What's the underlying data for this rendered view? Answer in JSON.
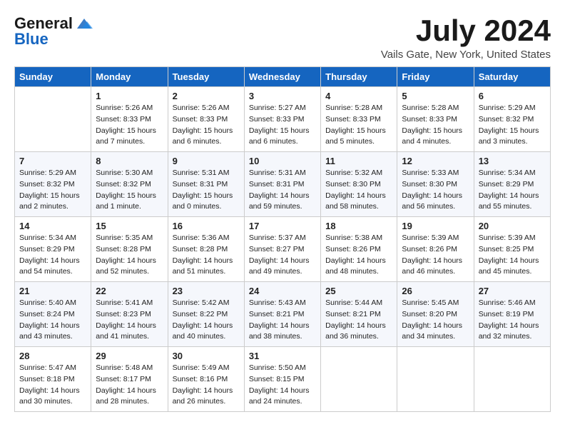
{
  "logo": {
    "general": "General",
    "blue": "Blue"
  },
  "title": "July 2024",
  "location": "Vails Gate, New York, United States",
  "headers": [
    "Sunday",
    "Monday",
    "Tuesday",
    "Wednesday",
    "Thursday",
    "Friday",
    "Saturday"
  ],
  "weeks": [
    [
      {
        "day": "",
        "sunrise": "",
        "sunset": "",
        "daylight": ""
      },
      {
        "day": "1",
        "sunrise": "Sunrise: 5:26 AM",
        "sunset": "Sunset: 8:33 PM",
        "daylight": "Daylight: 15 hours and 7 minutes."
      },
      {
        "day": "2",
        "sunrise": "Sunrise: 5:26 AM",
        "sunset": "Sunset: 8:33 PM",
        "daylight": "Daylight: 15 hours and 6 minutes."
      },
      {
        "day": "3",
        "sunrise": "Sunrise: 5:27 AM",
        "sunset": "Sunset: 8:33 PM",
        "daylight": "Daylight: 15 hours and 6 minutes."
      },
      {
        "day": "4",
        "sunrise": "Sunrise: 5:28 AM",
        "sunset": "Sunset: 8:33 PM",
        "daylight": "Daylight: 15 hours and 5 minutes."
      },
      {
        "day": "5",
        "sunrise": "Sunrise: 5:28 AM",
        "sunset": "Sunset: 8:33 PM",
        "daylight": "Daylight: 15 hours and 4 minutes."
      },
      {
        "day": "6",
        "sunrise": "Sunrise: 5:29 AM",
        "sunset": "Sunset: 8:32 PM",
        "daylight": "Daylight: 15 hours and 3 minutes."
      }
    ],
    [
      {
        "day": "7",
        "sunrise": "Sunrise: 5:29 AM",
        "sunset": "Sunset: 8:32 PM",
        "daylight": "Daylight: 15 hours and 2 minutes."
      },
      {
        "day": "8",
        "sunrise": "Sunrise: 5:30 AM",
        "sunset": "Sunset: 8:32 PM",
        "daylight": "Daylight: 15 hours and 1 minute."
      },
      {
        "day": "9",
        "sunrise": "Sunrise: 5:31 AM",
        "sunset": "Sunset: 8:31 PM",
        "daylight": "Daylight: 15 hours and 0 minutes."
      },
      {
        "day": "10",
        "sunrise": "Sunrise: 5:31 AM",
        "sunset": "Sunset: 8:31 PM",
        "daylight": "Daylight: 14 hours and 59 minutes."
      },
      {
        "day": "11",
        "sunrise": "Sunrise: 5:32 AM",
        "sunset": "Sunset: 8:30 PM",
        "daylight": "Daylight: 14 hours and 58 minutes."
      },
      {
        "day": "12",
        "sunrise": "Sunrise: 5:33 AM",
        "sunset": "Sunset: 8:30 PM",
        "daylight": "Daylight: 14 hours and 56 minutes."
      },
      {
        "day": "13",
        "sunrise": "Sunrise: 5:34 AM",
        "sunset": "Sunset: 8:29 PM",
        "daylight": "Daylight: 14 hours and 55 minutes."
      }
    ],
    [
      {
        "day": "14",
        "sunrise": "Sunrise: 5:34 AM",
        "sunset": "Sunset: 8:29 PM",
        "daylight": "Daylight: 14 hours and 54 minutes."
      },
      {
        "day": "15",
        "sunrise": "Sunrise: 5:35 AM",
        "sunset": "Sunset: 8:28 PM",
        "daylight": "Daylight: 14 hours and 52 minutes."
      },
      {
        "day": "16",
        "sunrise": "Sunrise: 5:36 AM",
        "sunset": "Sunset: 8:28 PM",
        "daylight": "Daylight: 14 hours and 51 minutes."
      },
      {
        "day": "17",
        "sunrise": "Sunrise: 5:37 AM",
        "sunset": "Sunset: 8:27 PM",
        "daylight": "Daylight: 14 hours and 49 minutes."
      },
      {
        "day": "18",
        "sunrise": "Sunrise: 5:38 AM",
        "sunset": "Sunset: 8:26 PM",
        "daylight": "Daylight: 14 hours and 48 minutes."
      },
      {
        "day": "19",
        "sunrise": "Sunrise: 5:39 AM",
        "sunset": "Sunset: 8:26 PM",
        "daylight": "Daylight: 14 hours and 46 minutes."
      },
      {
        "day": "20",
        "sunrise": "Sunrise: 5:39 AM",
        "sunset": "Sunset: 8:25 PM",
        "daylight": "Daylight: 14 hours and 45 minutes."
      }
    ],
    [
      {
        "day": "21",
        "sunrise": "Sunrise: 5:40 AM",
        "sunset": "Sunset: 8:24 PM",
        "daylight": "Daylight: 14 hours and 43 minutes."
      },
      {
        "day": "22",
        "sunrise": "Sunrise: 5:41 AM",
        "sunset": "Sunset: 8:23 PM",
        "daylight": "Daylight: 14 hours and 41 minutes."
      },
      {
        "day": "23",
        "sunrise": "Sunrise: 5:42 AM",
        "sunset": "Sunset: 8:22 PM",
        "daylight": "Daylight: 14 hours and 40 minutes."
      },
      {
        "day": "24",
        "sunrise": "Sunrise: 5:43 AM",
        "sunset": "Sunset: 8:21 PM",
        "daylight": "Daylight: 14 hours and 38 minutes."
      },
      {
        "day": "25",
        "sunrise": "Sunrise: 5:44 AM",
        "sunset": "Sunset: 8:21 PM",
        "daylight": "Daylight: 14 hours and 36 minutes."
      },
      {
        "day": "26",
        "sunrise": "Sunrise: 5:45 AM",
        "sunset": "Sunset: 8:20 PM",
        "daylight": "Daylight: 14 hours and 34 minutes."
      },
      {
        "day": "27",
        "sunrise": "Sunrise: 5:46 AM",
        "sunset": "Sunset: 8:19 PM",
        "daylight": "Daylight: 14 hours and 32 minutes."
      }
    ],
    [
      {
        "day": "28",
        "sunrise": "Sunrise: 5:47 AM",
        "sunset": "Sunset: 8:18 PM",
        "daylight": "Daylight: 14 hours and 30 minutes."
      },
      {
        "day": "29",
        "sunrise": "Sunrise: 5:48 AM",
        "sunset": "Sunset: 8:17 PM",
        "daylight": "Daylight: 14 hours and 28 minutes."
      },
      {
        "day": "30",
        "sunrise": "Sunrise: 5:49 AM",
        "sunset": "Sunset: 8:16 PM",
        "daylight": "Daylight: 14 hours and 26 minutes."
      },
      {
        "day": "31",
        "sunrise": "Sunrise: 5:50 AM",
        "sunset": "Sunset: 8:15 PM",
        "daylight": "Daylight: 14 hours and 24 minutes."
      },
      {
        "day": "",
        "sunrise": "",
        "sunset": "",
        "daylight": ""
      },
      {
        "day": "",
        "sunrise": "",
        "sunset": "",
        "daylight": ""
      },
      {
        "day": "",
        "sunrise": "",
        "sunset": "",
        "daylight": ""
      }
    ]
  ]
}
